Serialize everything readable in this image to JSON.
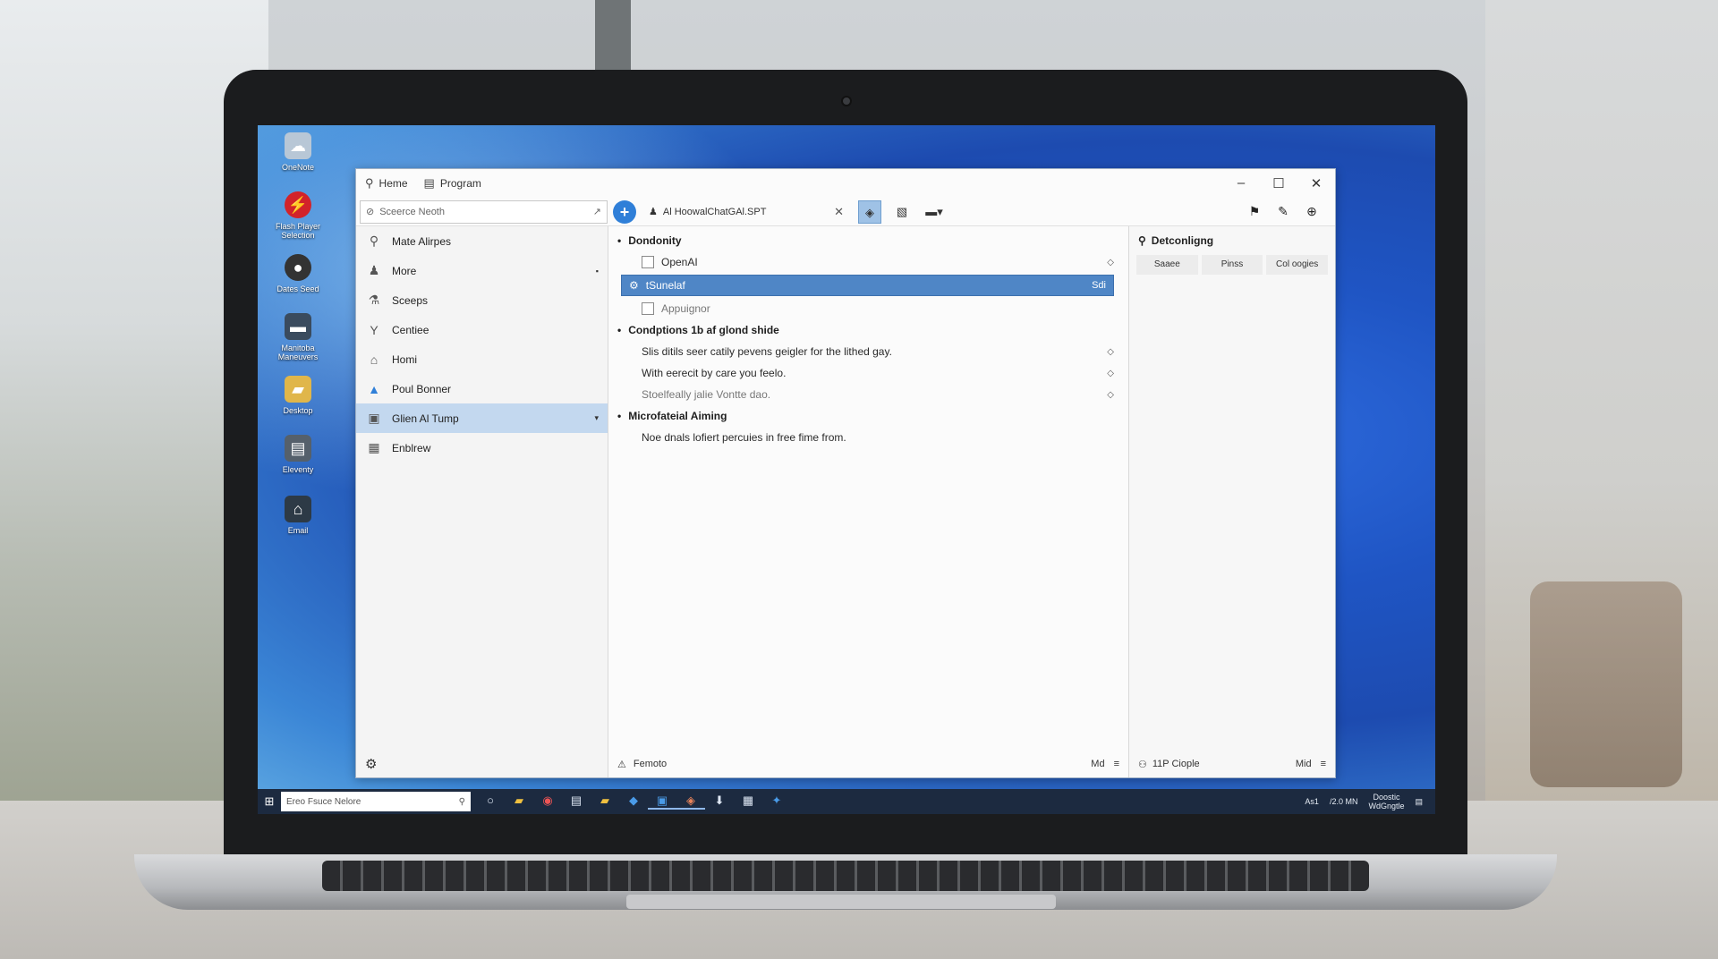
{
  "desktop": {
    "icons": [
      {
        "label": "OneNote",
        "glyph": "☁",
        "color": "#b8c7d6"
      },
      {
        "label": "Flash Player Selection",
        "glyph": "⚡",
        "color": "#d2232a"
      },
      {
        "label": "Dates Seed",
        "glyph": "●",
        "color": "#333333"
      },
      {
        "label": "Manitoba Maneuvers",
        "glyph": "▬",
        "color": "#3a4b5e"
      },
      {
        "label": "Desktop",
        "glyph": "▰",
        "color": "#e0b64a"
      },
      {
        "label": "Eleventy",
        "glyph": "▤",
        "color": "#55606b"
      },
      {
        "label": "Email",
        "glyph": "⌂",
        "color": "#2d3a46"
      }
    ]
  },
  "window": {
    "menu": [
      {
        "label": "Heme",
        "icon": "pin-icon"
      },
      {
        "label": "Program",
        "icon": "program-icon"
      }
    ],
    "controls": {
      "minimize": "–",
      "maximize": "☐",
      "close": "✕"
    }
  },
  "toolbar": {
    "search_placeholder": "Sceerce Neoth",
    "add_label": "+",
    "doc_tab": "Al HoowalChatGAl.SPT",
    "doc_tab_close": "✕"
  },
  "sidebar": {
    "items": [
      {
        "label": "Mate Alirpes",
        "icon": "pin-icon",
        "glyph": "⚲"
      },
      {
        "label": "More",
        "icon": "user-icon",
        "glyph": "♟",
        "caret": "▪"
      },
      {
        "label": "Sceeps",
        "icon": "flask-icon",
        "glyph": "⚗"
      },
      {
        "label": "Centiee",
        "icon": "tool-icon",
        "glyph": "Y"
      },
      {
        "label": "Homi",
        "icon": "home-icon",
        "glyph": "⌂"
      },
      {
        "label": "Poul Bonner",
        "icon": "warning-icon",
        "glyph": "▲"
      },
      {
        "label": "Glien Al Tump",
        "icon": "app-icon",
        "glyph": "▣",
        "caret": "▾",
        "selected": true
      },
      {
        "label": "Enblrew",
        "icon": "grid-icon",
        "glyph": "▦"
      }
    ],
    "footer_icon": "⚙"
  },
  "main": {
    "sections": [
      {
        "title": "Dondonity"
      },
      {
        "title": "Condptions 1b af glond shide"
      },
      {
        "title": "Microfateial Aiming"
      }
    ],
    "rows": {
      "openai": "OpenAI",
      "highlighted": "tSunelaf",
      "highlighted_tail": "Sdi",
      "appuignor": "Appuignor",
      "line1": "Slis ditils seer catily pevens geigler for the lithed gay.",
      "line2": "With eerecit by care you feelo.",
      "line3": "Stoelfeally jalie Vontte dao.",
      "line4": "Noe dnals lofiert percuies in free fime from."
    },
    "footer": {
      "label": "Femoto",
      "right1": "Md",
      "right2": "≡"
    }
  },
  "right_panel": {
    "title": "Detconligng",
    "tabs": [
      "Saaee",
      "Pinss",
      "Col oogies"
    ],
    "footer": {
      "label": "11P Ciople",
      "right1": "Mid",
      "right2": "≡"
    }
  },
  "taskbar": {
    "search_placeholder": "Ereo Fsuce Nelore",
    "apps": [
      "○",
      "▰",
      "◉",
      "▤",
      "▰",
      "◆",
      "▣",
      "◈",
      "⬇",
      "▦",
      "✦"
    ],
    "tray": {
      "left": "As1",
      "time": "/2.0 MN",
      "date_line1": "Doostic",
      "date_line2": "WdGngtle"
    }
  }
}
